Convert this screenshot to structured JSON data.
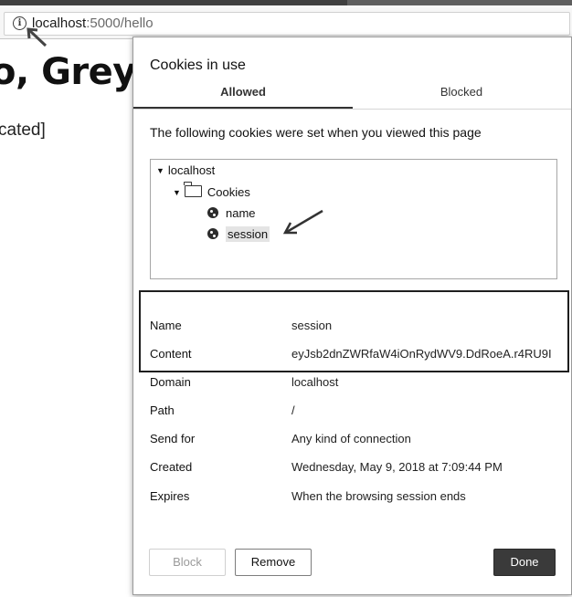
{
  "browser": {
    "url_host": "localhost",
    "url_path": ":5000/hello"
  },
  "page": {
    "heading": "o, Grey!",
    "subtext": "cated]"
  },
  "dialog": {
    "title": "Cookies in use",
    "tabs": [
      {
        "label": "Allowed",
        "active": true
      },
      {
        "label": "Blocked",
        "active": false
      }
    ],
    "description": "The following cookies were set when you viewed this page",
    "tree": {
      "root": "localhost",
      "folder": "Cookies",
      "items": [
        "name",
        "session"
      ],
      "selected": "session"
    },
    "details": [
      {
        "key": "Name",
        "value": "session"
      },
      {
        "key": "Content",
        "value": "eyJsb2dnZWRfaW4iOnRydWV9.DdRoeA.r4RU9I"
      },
      {
        "key": "Domain",
        "value": "localhost"
      },
      {
        "key": "Path",
        "value": "/"
      },
      {
        "key": "Send for",
        "value": "Any kind of connection"
      },
      {
        "key": "Created",
        "value": "Wednesday, May 9, 2018 at 7:09:44 PM"
      },
      {
        "key": "Expires",
        "value": "When the browsing session ends"
      }
    ],
    "buttons": {
      "block": "Block",
      "remove": "Remove",
      "done": "Done"
    }
  },
  "icons": {
    "info": "info-icon",
    "folder": "folder-icon",
    "cookie": "cookie-icon"
  },
  "colors": {
    "done_button": "#3a3a3a",
    "highlight_border": "#1e1e1e"
  }
}
